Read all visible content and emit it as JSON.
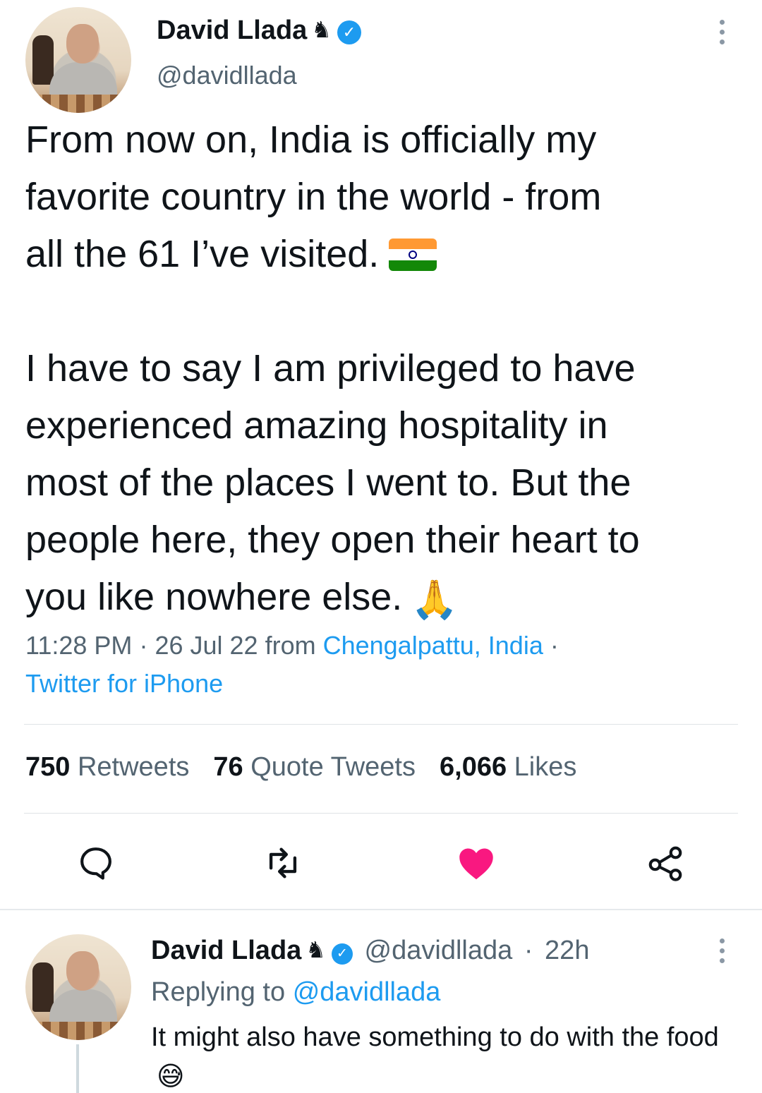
{
  "tweet": {
    "author_name": "David Llada",
    "author_handle": "@davidllada",
    "author_badge_icon": "chess-knight-icon",
    "text_line1": "From now on, India is officially my",
    "text_line2": "favorite country in the world - from",
    "text_line3": "all the 61 I’ve visited.",
    "text_line4": "I have to say I am privileged to have",
    "text_line5": "experienced amazing hospitality in",
    "text_line6": "most of the places I went to. But the",
    "text_line7": "people here, they open their heart to",
    "text_line8": "you like nowhere else.",
    "time": "11:28 PM",
    "date": "26 Jul 22",
    "from_label": "from",
    "location": "Chengalpattu, India",
    "source": "Twitter for iPhone",
    "separator": "·"
  },
  "stats": {
    "retweets_count": "750",
    "retweets_label": "Retweets",
    "quotes_count": "76",
    "quotes_label": "Quote Tweets",
    "likes_count": "6,066",
    "likes_label": "Likes"
  },
  "actions": {
    "reply_icon": "reply-icon",
    "retweet_icon": "retweet-icon",
    "like_icon": "heart-icon",
    "share_icon": "share-icon",
    "like_color": "#f91880"
  },
  "reply": {
    "author_name": "David Llada",
    "author_handle": "@davidllada",
    "time_ago": "22h",
    "separator": "·",
    "replying_prefix": "Replying to",
    "replying_handle": "@davidllada",
    "text": "It might also have something to do with the food"
  },
  "colors": {
    "accent": "#1d9bf0",
    "secondary_text": "#536471",
    "primary_text": "#0f1419"
  }
}
